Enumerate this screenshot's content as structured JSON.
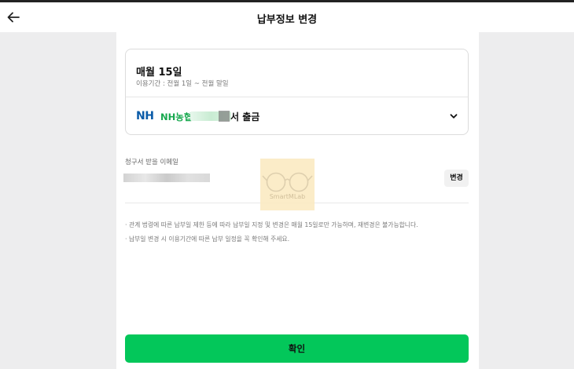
{
  "header": {
    "title": "납부정보 변경"
  },
  "card": {
    "day": "매월 15일",
    "period": "이용기간 : 전월 1일 ~ 전월 말일",
    "bank_logo": "NH",
    "bank_name": "NH농협",
    "withdraw_suffix": "서 출금"
  },
  "email": {
    "label": "청구서 받을 이메일",
    "change_label": "변경"
  },
  "notes": [
    "· 관계 법령에 따른 납부일 제한 등에 따라 납부일 지정 및 변경은 매월 15일로만 가능하며, 재변경은 불가능합니다.",
    "· 납부일 변경 시 이용기간에 따른 납부 일정을 꼭 확인해 주세요."
  ],
  "watermark": {
    "text": "SmartMLab"
  },
  "confirm_label": "확인",
  "colors": {
    "accent": "#03c75a",
    "nh_blue": "#0a5ba8",
    "nh_green": "#17a84e"
  }
}
